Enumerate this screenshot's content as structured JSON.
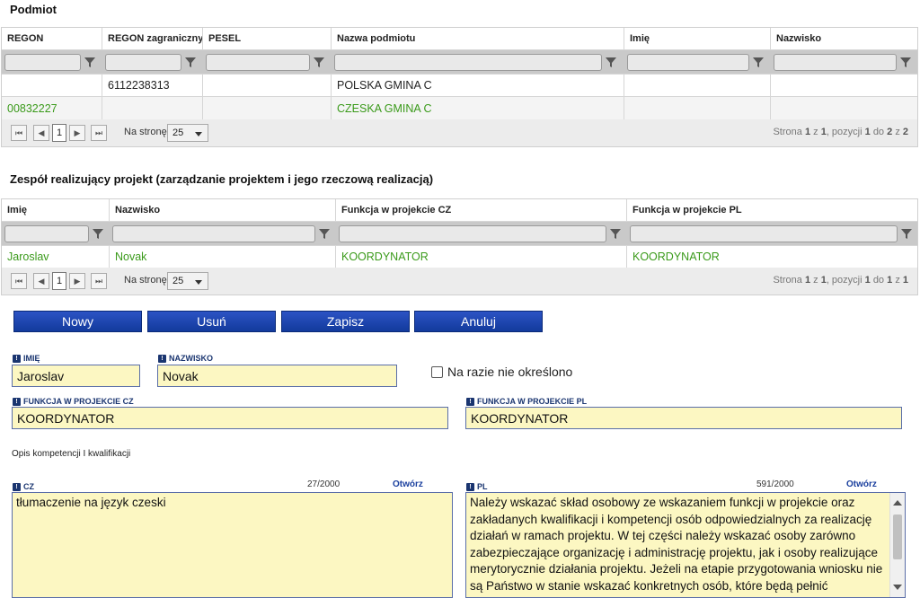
{
  "podmiot": {
    "title": "Podmiot",
    "columns": [
      "REGON",
      "REGON zagraniczny",
      "PESEL",
      "Nazwa podmiotu",
      "Imię",
      "Nazwisko"
    ],
    "rows": [
      [
        "",
        "6112238313",
        "",
        "POLSKA GMINA C",
        "",
        ""
      ],
      [
        "00832227",
        "",
        "",
        "CZESKA GMINA C",
        "",
        ""
      ]
    ],
    "pager": {
      "page": "1",
      "per_page_label": "Na stronę",
      "per_page": "25",
      "info_prefix": "Strona",
      "info_page": "1",
      "info_z1": "z",
      "info_pages": "1",
      "info_pos": ", pozycji",
      "info_from": "1",
      "info_do": "do",
      "info_to": "2",
      "info_z2": "z",
      "info_total": "2"
    }
  },
  "zespol": {
    "title": "Zespół realizujący projekt (zarządzanie projektem i jego rzeczową realizacją)",
    "columns": [
      "Imię",
      "Nazwisko",
      "Funkcja w projekcie CZ",
      "Funkcja w projekcie PL"
    ],
    "rows": [
      [
        "Jaroslav",
        "Novak",
        "KOORDYNATOR",
        "KOORDYNATOR"
      ]
    ],
    "pager": {
      "page": "1",
      "per_page_label": "Na stronę",
      "per_page": "25",
      "info_prefix": "Strona",
      "info_page": "1",
      "info_z1": "z",
      "info_pages": "1",
      "info_pos": ", pozycji",
      "info_from": "1",
      "info_do": "do",
      "info_to": "1",
      "info_z2": "z",
      "info_total": "1"
    }
  },
  "toolbar": {
    "new_label": "Nowy",
    "delete_label": "Usuń",
    "save_label": "Zapisz",
    "cancel_label": "Anuluj"
  },
  "form": {
    "req_glyph": "!",
    "imie_label": "Imię",
    "imie_value": "Jaroslav",
    "nazwisko_label": "Nazwisko",
    "nazwisko_value": "Novak",
    "unset_label": "Na razie nie określono",
    "funkcja_cz_label": "Funkcja w projekcie CZ",
    "funkcja_cz_value": "KOORDYNATOR",
    "funkcja_pl_label": "Funkcja w projekcie PL",
    "funkcja_pl_value": "KOORDYNATOR",
    "opis_label": "Opis kompetencji I kwalifikacji",
    "cz_label": "CZ",
    "cz_counter": "27/2000",
    "cz_open": "Otwórz",
    "cz_text": "tłumaczenie na język czeski",
    "pl_label": "PL",
    "pl_counter": "591/2000",
    "pl_open": "Otwórz",
    "pl_text": "Należy wskazać skład osobowy ze wskazaniem funkcji w projekcie oraz zakładanych kwalifikacji i kompetencji osób odpowiedzialnych za realizację działań w ramach projektu. W tej części należy wskazać osoby zarówno zabezpieczające organizację i administrację projektu, jak i osoby realizujące merytorycznie działania projektu. Jeżeli na etapie przygotowania wniosku nie są Państwo w stanie wskazać konkretnych osób, które będą pełnić planowane funkcje w ramach projektu, prosimy o wskazanie jedynie"
  }
}
